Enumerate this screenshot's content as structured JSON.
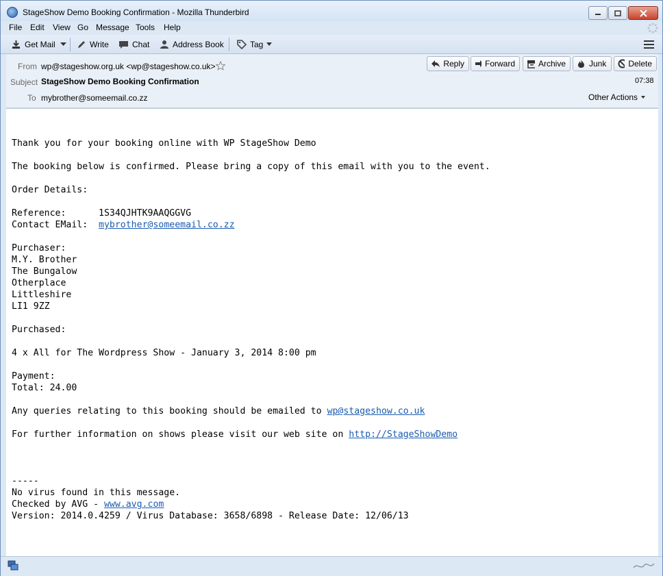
{
  "window": {
    "title": "StageShow Demo Booking Confirmation - Mozilla Thunderbird"
  },
  "menu": [
    "File",
    "Edit",
    "View",
    "Go",
    "Message",
    "Tools",
    "Help"
  ],
  "toolbar": {
    "get_mail": "Get Mail",
    "write": "Write",
    "chat": "Chat",
    "address_book": "Address Book",
    "tag": "Tag"
  },
  "header": {
    "from_label": "From",
    "from_value": "wp@stageshow.org.uk <wp@stageshow.co.uk>",
    "subject_label": "Subject",
    "subject_value": "StageShow Demo Booking Confirmation",
    "to_label": "To",
    "to_value": "mybrother@someemail.co.zz",
    "time": "07:38",
    "other_actions": "Other Actions",
    "buttons": {
      "reply": "Reply",
      "forward": "Forward",
      "archive": "Archive",
      "junk": "Junk",
      "delete": "Delete"
    }
  },
  "message": {
    "thanks": "Thank you for your booking online with WP StageShow Demo",
    "confirmed": "The booking below is confirmed. Please bring a copy of this email with you to the event.",
    "order_details": "Order Details:",
    "reference_label": "Reference:      ",
    "reference_value": "1S34QJHTK9AAQGGVG",
    "contact_label": "Contact EMail:  ",
    "contact_value": "mybrother@someemail.co.zz",
    "purchaser_label": "Purchaser:",
    "purchaser_lines": [
      "M.Y. Brother",
      "The Bungalow",
      "Otherplace",
      "Littleshire",
      "LI1 9ZZ"
    ],
    "purchased_label": "Purchased:",
    "purchased_item": "4 x All for The Wordpress Show - January 3, 2014 8:00 pm",
    "payment_label": "Payment:",
    "total": "Total: 24.00",
    "queries_text": "Any queries relating to this booking should be emailed to ",
    "queries_link": "wp@stageshow.co.uk",
    "info_text": "For further information on shows please visit our web site on ",
    "info_link": "http://StageShowDemo",
    "sig_sep": "-----",
    "virus_line": "No virus found in this message.",
    "checked_text": "Checked by AVG - ",
    "checked_link": "www.avg.com",
    "version_line": "Version: 2014.0.4259 / Virus Database: 3658/6898 - Release Date: 12/06/13"
  },
  "colors": {
    "link": "#1a5bb0",
    "frame": "#dde8f5",
    "header_bg": "#eaf0f7"
  }
}
